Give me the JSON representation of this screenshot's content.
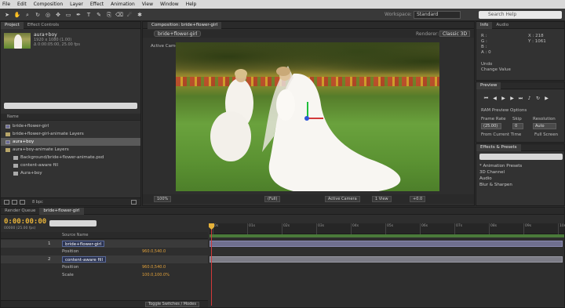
{
  "menubar": [
    "File",
    "Edit",
    "Composition",
    "Layer",
    "Effect",
    "Animation",
    "View",
    "Window",
    "Help"
  ],
  "toolbar": {
    "tools": [
      "selection-tool-icon",
      "hand-tool-icon",
      "zoom-tool-icon",
      "rotation-tool-icon",
      "camera-orbit-icon",
      "pan-behind-icon",
      "rectangle-mask-icon",
      "pen-tool-icon",
      "text-tool-icon",
      "brush-tool-icon",
      "clone-stamp-icon",
      "eraser-icon",
      "roto-brush-icon",
      "puppet-pin-icon"
    ],
    "workspace_label": "Workspace:",
    "workspace_value": "Standard",
    "search_placeholder": "Search Help"
  },
  "project": {
    "tabs": [
      "Project",
      "Effect Controls"
    ],
    "selected_name": "aura+boy",
    "meta1": "1920 x 1080 (1.00)",
    "meta2": "Δ 0:00:05:00, 25.00 fps",
    "columns": "Name",
    "items": [
      {
        "label": "bride+flower-girl",
        "type": "comp",
        "indent": false,
        "selected": false
      },
      {
        "label": "bride+flower-girl-animate Layers",
        "type": "folder",
        "indent": false,
        "selected": false
      },
      {
        "label": "aura+boy",
        "type": "comp",
        "indent": false,
        "selected": true
      },
      {
        "label": "aura+boy-animate Layers",
        "type": "folder",
        "indent": false,
        "selected": false
      },
      {
        "label": "Background/bride+flower-animate.psd",
        "type": "file",
        "indent": true,
        "selected": false
      },
      {
        "label": "content-aware fill",
        "type": "file",
        "indent": true,
        "selected": false
      },
      {
        "label": "Aura+boy",
        "type": "file",
        "indent": true,
        "selected": false
      }
    ],
    "bpc": "8 bpc"
  },
  "composition": {
    "tab": "Composition: bride+flower-girl",
    "crumb": "bride+flower-girl",
    "renderer_label": "Renderer:",
    "renderer_value": "Classic 3D",
    "active_camera": "Active Camera",
    "controls": [
      "100%",
      "(Full)",
      "Active Camera",
      "1 View",
      "+0.0"
    ]
  },
  "info": {
    "tabs": [
      "Info",
      "Audio"
    ],
    "lines": [
      {
        "label": "R :",
        "value": "X : 218"
      },
      {
        "label": "G :",
        "value": "Y : 1061"
      },
      {
        "label": "B :",
        "value": ""
      },
      {
        "label": "A : 0",
        "value": ""
      }
    ],
    "undo": "Undo",
    "undo_action": "Change Value"
  },
  "preview": {
    "tab": "Preview",
    "ram_label": "RAM Preview Options",
    "frame_rate_label": "Frame Rate",
    "skip_label": "Skip",
    "resolution_label": "Resolution",
    "frame_rate": "(25.00)",
    "skip": "0",
    "resolution": "Auto",
    "from_current": "From Current Time",
    "full_screen": "Full Screen"
  },
  "effects": {
    "tab": "Effects & Presets",
    "items": [
      "* Animation Presets",
      "3D Channel",
      "Audio",
      "Blur & Sharpen"
    ]
  },
  "timeline": {
    "tabs": [
      "Render Queue",
      "bride+flower-girl"
    ],
    "time": "0:00:00:00",
    "frame_info": "00000 (25.00 fps)",
    "colhead": "Source Name",
    "layers": [
      {
        "num": "1",
        "name": "bride+flower-girl",
        "main": true
      },
      {
        "prop": "Position",
        "value": "960.0,540.0"
      },
      {
        "num": "2",
        "name": "content-aware fill",
        "main": true
      },
      {
        "prop": "Position",
        "value": "960.0,540.0"
      },
      {
        "prop": "Scale",
        "value": "100.0,100.0%"
      }
    ],
    "toggle_label": "Toggle Switches / Modes",
    "ruler": [
      "0s",
      "01s",
      "02s",
      "03s",
      "04s",
      "05s",
      "06s",
      "07s",
      "08s",
      "09s",
      "10s"
    ]
  }
}
